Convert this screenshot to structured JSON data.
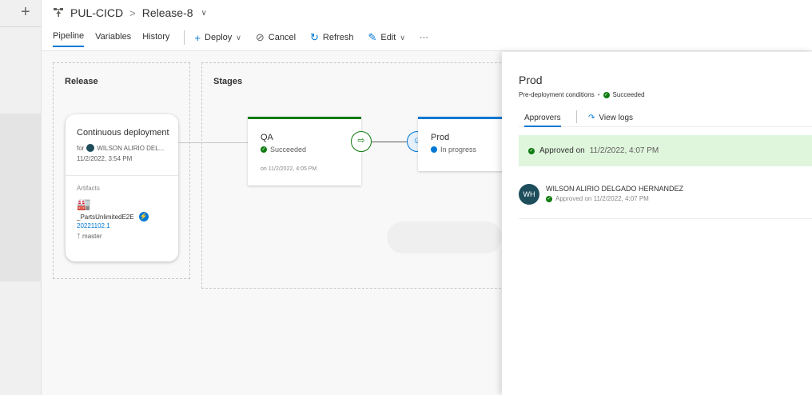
{
  "header": {
    "project": "PUL-CICD",
    "separator": ">",
    "release": "Release-8"
  },
  "tabs": [
    "Pipeline",
    "Variables",
    "History"
  ],
  "toolbar": {
    "deploy": "Deploy",
    "cancel": "Cancel",
    "refresh": "Refresh",
    "edit": "Edit",
    "more": "···"
  },
  "release_section": {
    "title": "Release",
    "card": {
      "title": "Continuous deployment",
      "for_prefix": "for",
      "user": "WILSON ALIRIO DEL...",
      "date": "11/2/2022, 3:54 PM",
      "artifacts_label": "Artifacts",
      "artifact_name": "_PartsUnlimitedE2E",
      "build": "20221102.1",
      "branch": "master"
    }
  },
  "stages_section": {
    "title": "Stages",
    "qa": {
      "name": "QA",
      "status": "Succeeded",
      "date": "on 11/2/2022, 4:05 PM"
    },
    "prod": {
      "name": "Prod",
      "status": "In progress"
    }
  },
  "panel": {
    "title": "Prod",
    "subtitle": "Pre-deployment conditions",
    "subtitle_sep": "•",
    "subtitle_status": "Succeeded",
    "tab_approvers": "Approvers",
    "tab_logs": "View logs",
    "banner_text": "Approved on",
    "banner_date": "11/2/2022, 4:07 PM",
    "approver": {
      "initials": "WH",
      "name": "WILSON ALIRIO DELGADO HERNANDEZ",
      "status": "Approved on 11/2/2022, 4:07 PM"
    }
  },
  "colors": {
    "accent": "#0078d4",
    "success": "#107c10",
    "success_banner": "#dff6dd",
    "avatar": "#1e4d5c"
  }
}
